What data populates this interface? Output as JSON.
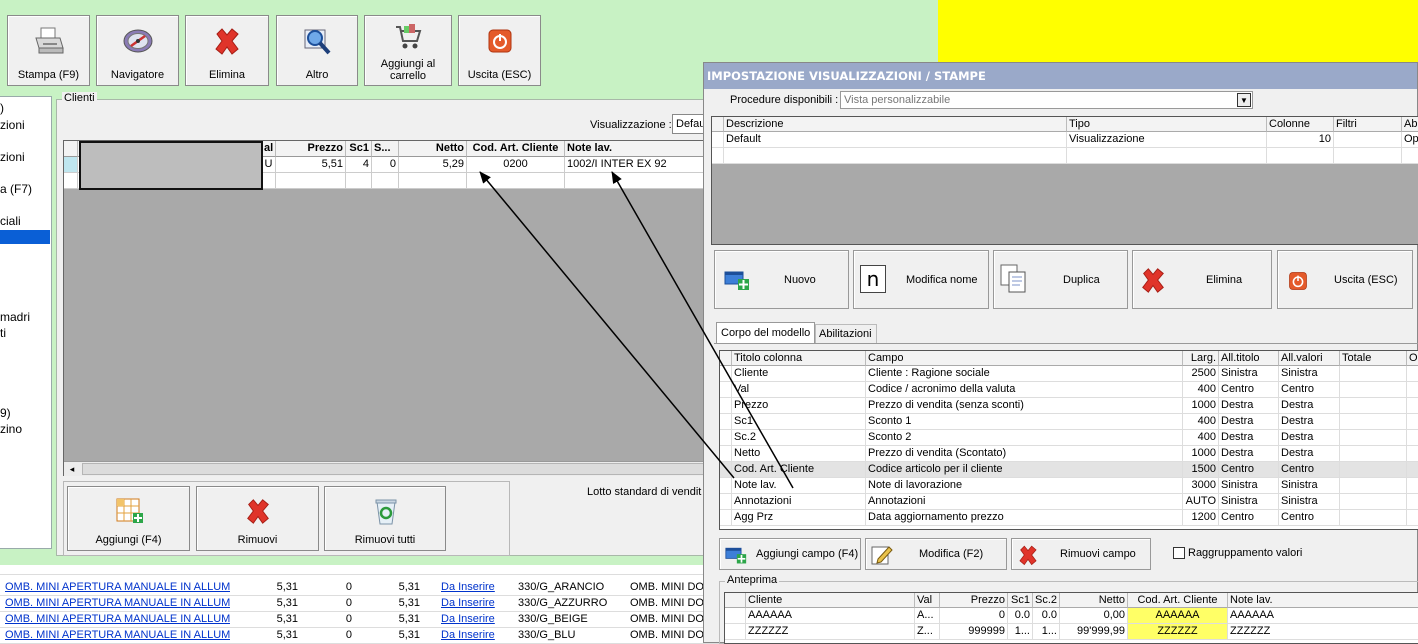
{
  "toolbar": {
    "buttons": [
      {
        "label": "Stampa (F9)"
      },
      {
        "label": "Navigatore"
      },
      {
        "label": "Elimina"
      },
      {
        "label": "Altro"
      },
      {
        "label": "Aggiungi al carrello"
      },
      {
        "label": "Uscita (ESC)"
      }
    ]
  },
  "leftnav": {
    "items": [
      ")",
      "zioni",
      "zioni",
      "a (F7)",
      "ciali",
      "madri",
      "ti",
      "9)",
      "zino"
    ]
  },
  "clienti": {
    "group_title": "Clienti",
    "visualizzazione_label": "Visualizzazione :",
    "visualizzazione_value": "Defau",
    "lotto_label": "Lotto standard di vendit",
    "columns": [
      "al",
      "Prezzo",
      "Sc1",
      "S...",
      "Netto",
      "Cod. Art. Cliente",
      "Note lav."
    ],
    "row": {
      "val": "U",
      "prezzo": "5,51",
      "sc1": "4",
      "sc2": "0",
      "netto": "5,29",
      "cod": "0200",
      "note": "1002/I INTER EX 92"
    },
    "buttons": [
      "Aggiungi (F4)",
      "Rimuovi",
      "Rimuovi tutti"
    ]
  },
  "bottom_table": {
    "rows": [
      {
        "desc": "OMB. MINI APERTURA MANUALE IN ALLUMI...",
        "prezzo": "5,31",
        "sc": "0",
        "netto": "5,31",
        "stato": "Da Inserire",
        "cod": "330/G_ARANCIO",
        "note": "OMB. MINI DO"
      },
      {
        "desc": "OMB. MINI APERTURA MANUALE IN ALLUMI...",
        "prezzo": "5,31",
        "sc": "0",
        "netto": "5,31",
        "stato": "Da Inserire",
        "cod": "330/G_AZZURRO",
        "note": "OMB. MINI DO"
      },
      {
        "desc": "OMB. MINI APERTURA MANUALE IN ALLUMI...",
        "prezzo": "5,31",
        "sc": "0",
        "netto": "5,31",
        "stato": "Da Inserire",
        "cod": "330/G_BEIGE",
        "note": "OMB. MINI DO"
      },
      {
        "desc": "OMB. MINI APERTURA MANUALE IN ALLUMI...",
        "prezzo": "5,31",
        "sc": "0",
        "netto": "5,31",
        "stato": "Da Inserire",
        "cod": "330/G_BLU",
        "note": "OMB. MINI DO"
      }
    ]
  },
  "dialog": {
    "title": "IMPOSTAZIONE VISUALIZZAZIONI / STAMPE",
    "procedure_label": "Procedure disponibili :",
    "procedure_value": "Vista personalizzabile",
    "views_columns": [
      "Descrizione",
      "Tipo",
      "Colonne",
      "Filtri",
      "Abi"
    ],
    "views_rows": [
      {
        "descrizione": "Default",
        "tipo": "Visualizzazione",
        "colonne": "10",
        "filtri": "",
        "abi": "Ope"
      }
    ],
    "action_buttons": [
      "Nuovo",
      "Modifica nome",
      "Duplica",
      "Elimina",
      "Uscita (ESC)"
    ],
    "tabs": [
      "Corpo del modello",
      "Abilitazioni"
    ],
    "fields_columns": [
      "Titolo colonna",
      "Campo",
      "Larg.",
      "All.titolo",
      "All.valori",
      "Totale",
      "Or"
    ],
    "fields_rows": [
      {
        "titolo": "Cliente",
        "campo": "Cliente : Ragione sociale",
        "larg": "2500",
        "alltitolo": "Sinistra",
        "allvalori": "Sinistra"
      },
      {
        "titolo": "Val",
        "campo": "Codice / acronimo della valuta",
        "larg": "400",
        "alltitolo": "Centro",
        "allvalori": "Centro"
      },
      {
        "titolo": "Prezzo",
        "campo": "Prezzo di vendita (senza sconti)",
        "larg": "1000",
        "alltitolo": "Destra",
        "allvalori": "Destra"
      },
      {
        "titolo": "Sc1",
        "campo": "Sconto 1",
        "larg": "400",
        "alltitolo": "Destra",
        "allvalori": "Destra"
      },
      {
        "titolo": "Sc.2",
        "campo": "Sconto 2",
        "larg": "400",
        "alltitolo": "Destra",
        "allvalori": "Destra"
      },
      {
        "titolo": "Netto",
        "campo": "Prezzo di vendita (Scontato)",
        "larg": "1000",
        "alltitolo": "Destra",
        "allvalori": "Destra"
      },
      {
        "titolo": "Cod. Art. Cliente",
        "campo": "Codice articolo per il cliente",
        "larg": "1500",
        "alltitolo": "Centro",
        "allvalori": "Centro"
      },
      {
        "titolo": "Note lav.",
        "campo": "Note di lavorazione",
        "larg": "3000",
        "alltitolo": "Sinistra",
        "allvalori": "Sinistra"
      },
      {
        "titolo": "Annotazioni",
        "campo": "Annotazioni",
        "larg": "AUTO",
        "alltitolo": "Sinistra",
        "allvalori": "Sinistra"
      },
      {
        "titolo": "Agg Prz",
        "campo": "Data aggiornamento prezzo",
        "larg": "1200",
        "alltitolo": "Centro",
        "allvalori": "Centro"
      }
    ],
    "field_buttons": [
      "Aggiungi campo (F4)",
      "Modifica (F2)",
      "Rimuovi campo"
    ],
    "raggruppamento_label": "Raggruppamento valori",
    "preview_title": "Anteprima",
    "preview_columns": [
      "Cliente",
      "Val",
      "Prezzo",
      "Sc1",
      "Sc.2",
      "Netto",
      "Cod. Art. Cliente",
      "Note lav."
    ],
    "preview_rows": [
      {
        "cliente": "AAAAAA",
        "val": "A...",
        "prezzo": "0",
        "sc1": "0.0",
        "sc2": "0.0",
        "netto": "0,00",
        "cod": "AAAAAA",
        "note": "AAAAAA"
      },
      {
        "cliente": "ZZZZZZ",
        "val": "Z...",
        "prezzo": "999999",
        "sc1": "1...",
        "sc2": "1...",
        "netto": "99'999,99",
        "cod": "ZZZZZZ",
        "note": "ZZZZZZ"
      }
    ]
  },
  "colors": {
    "green_bg": "#c8f2c4",
    "yellow": "#ffff00",
    "title_bar": "#9aa9c9",
    "highlight": "#ffff66",
    "selection": "#0a5fd6"
  }
}
